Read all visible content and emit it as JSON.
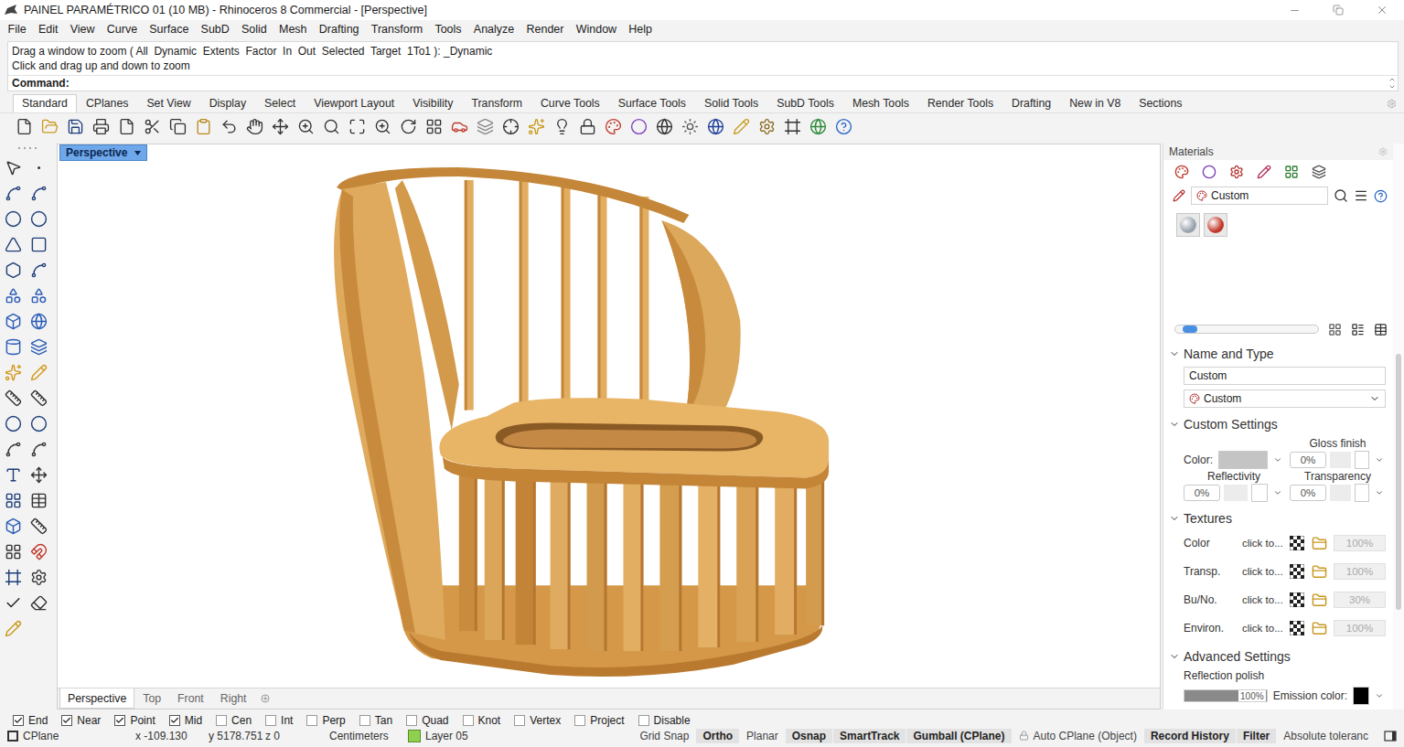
{
  "window": {
    "title": "PAINEL PARAMÉTRICO 01 (10 MB) - Rhinoceros 8 Commercial - [Perspective]"
  },
  "menu": [
    "File",
    "Edit",
    "View",
    "Curve",
    "Surface",
    "SubD",
    "Solid",
    "Mesh",
    "Drafting",
    "Transform",
    "Tools",
    "Analyze",
    "Render",
    "Window",
    "Help"
  ],
  "command": {
    "history": [
      "Drag a window to zoom ( All  Dynamic  Extents  Factor  In  Out  Selected  Target  1To1 ): _Dynamic",
      "Click and drag up and down to zoom"
    ],
    "prompt": "Command:"
  },
  "toolbar_tabs": [
    {
      "label": "Standard",
      "selected": true
    },
    {
      "label": "CPlanes",
      "selected": false
    },
    {
      "label": "Set View",
      "selected": false
    },
    {
      "label": "Display",
      "selected": false
    },
    {
      "label": "Select",
      "selected": false
    },
    {
      "label": "Viewport Layout",
      "selected": false
    },
    {
      "label": "Visibility",
      "selected": false
    },
    {
      "label": "Transform",
      "selected": false
    },
    {
      "label": "Curve Tools",
      "selected": false
    },
    {
      "label": "Surface Tools",
      "selected": false
    },
    {
      "label": "Solid Tools",
      "selected": false
    },
    {
      "label": "SubD Tools",
      "selected": false
    },
    {
      "label": "Mesh Tools",
      "selected": false
    },
    {
      "label": "Render Tools",
      "selected": false
    },
    {
      "label": "Drafting",
      "selected": false
    },
    {
      "label": "New in V8",
      "selected": false
    },
    {
      "label": "Sections",
      "selected": false
    }
  ],
  "viewport": {
    "title": "Perspective",
    "tabs": [
      {
        "label": "Perspective",
        "selected": true
      },
      {
        "label": "Top",
        "selected": false
      },
      {
        "label": "Front",
        "selected": false
      },
      {
        "label": "Right",
        "selected": false
      }
    ]
  },
  "materials": {
    "title": "Materials",
    "search": "Custom",
    "thumbnails": [
      {
        "color": "#9aa3ad",
        "selected": false
      },
      {
        "color": "#c0392b",
        "selected": false
      }
    ],
    "size_level": 0.05,
    "name_and_type": {
      "heading": "Name and Type",
      "expanded": true,
      "name": "Custom",
      "type": "Custom"
    },
    "custom_settings": {
      "heading": "Custom Settings",
      "expanded": true,
      "color_label": "Color:",
      "color": "#c4c4c4",
      "gloss": {
        "label": "Gloss finish",
        "value": "0%",
        "level": 0,
        "color": "#ffffff"
      },
      "reflectivity": {
        "label": "Reflectivity",
        "value": "0%",
        "color": "#ffffff"
      },
      "transparency": {
        "label": "Transparency",
        "value": "0%",
        "color": "#ffffff"
      }
    },
    "textures": {
      "heading": "Textures",
      "expanded": true,
      "rows": [
        {
          "label": "Color",
          "link": "click to...",
          "amount": "100%",
          "enabled": false
        },
        {
          "label": "Transp.",
          "link": "click to...",
          "amount": "100%",
          "enabled": false
        },
        {
          "label": "Bu/No.",
          "link": "click to...",
          "amount": "30%",
          "enabled": false
        },
        {
          "label": "Environ.",
          "link": "click to...",
          "amount": "100%",
          "enabled": false
        }
      ]
    },
    "advanced": {
      "heading": "Advanced Settings",
      "expanded": true,
      "reflection_polish": {
        "label": "Reflection polish",
        "value": "100%",
        "level": 1
      },
      "emission": {
        "label": "Emission color:",
        "color": "#000000"
      }
    }
  },
  "osnaps": [
    {
      "label": "End",
      "checked": true
    },
    {
      "label": "Near",
      "checked": true
    },
    {
      "label": "Point",
      "checked": true
    },
    {
      "label": "Mid",
      "checked": true
    },
    {
      "label": "Cen",
      "checked": false
    },
    {
      "label": "Int",
      "checked": false
    },
    {
      "label": "Perp",
      "checked": false
    },
    {
      "label": "Tan",
      "checked": false
    },
    {
      "label": "Quad",
      "checked": false
    },
    {
      "label": "Knot",
      "checked": false
    },
    {
      "label": "Vertex",
      "checked": false
    },
    {
      "label": "Project",
      "checked": false
    },
    {
      "label": "Disable",
      "checked": false
    }
  ],
  "status_bar": {
    "cplane": "CPlane",
    "coords": [
      "x -109.130",
      "y 5178.751",
      "z 0"
    ],
    "units": "Centimeters",
    "layer": {
      "name": "Layer 05",
      "color": "#8fd14f"
    },
    "panes": [
      {
        "label": "Grid Snap",
        "on": false,
        "kind": "toggle"
      },
      {
        "label": "Ortho",
        "on": true,
        "kind": "toggle"
      },
      {
        "label": "Planar",
        "on": false,
        "kind": "toggle"
      },
      {
        "label": "Osnap",
        "on": true,
        "kind": "toggle"
      },
      {
        "label": "SmartTrack",
        "on": true,
        "kind": "toggle"
      },
      {
        "label": "Gumball (CPlane)",
        "on": true,
        "kind": "toggle"
      },
      {
        "label": "Auto CPlane (Object)",
        "on": false,
        "kind": "locked"
      },
      {
        "label": "Record History",
        "on": true,
        "kind": "toggle"
      },
      {
        "label": "Filter",
        "on": true,
        "kind": "toggle"
      },
      {
        "label": "Absolute toleranc",
        "on": false,
        "kind": "toggle"
      }
    ]
  }
}
